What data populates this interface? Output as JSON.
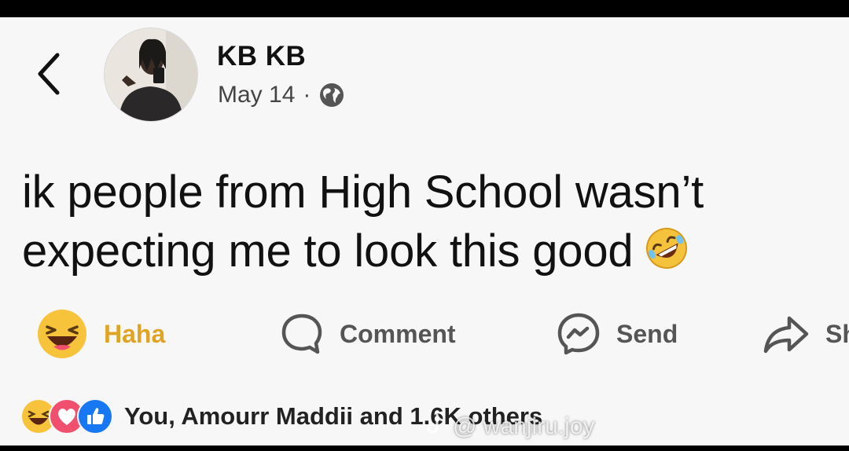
{
  "post": {
    "author_name": "KB KB",
    "date": "May 14",
    "separator": "·",
    "text_line_1": "ik people from High School wasn’t",
    "text_line_2": "expecting me to look this good"
  },
  "icons": {
    "back": "chevron-left-icon",
    "privacy": "globe-icon",
    "text_emoji": "rolling-on-floor-laughing-emoji",
    "haha": "haha-reaction-icon",
    "comment": "comment-bubble-icon",
    "send": "messenger-icon",
    "share": "share-arrow-icon"
  },
  "actions": {
    "haha_label": "Haha",
    "comment_label": "Comment",
    "send_label": "Send",
    "share_label": "Sh"
  },
  "reactions": {
    "summary": "You, Amourr Maddii and 1.6K others"
  },
  "watermark": {
    "handle": "@ wanjiru.joy"
  },
  "colors": {
    "background": "#f7f7f7",
    "haha_active": "#e0a424",
    "like_blue": "#1877f2",
    "love_red": "#f0506e",
    "haha_yellow": "#f7c33b"
  }
}
